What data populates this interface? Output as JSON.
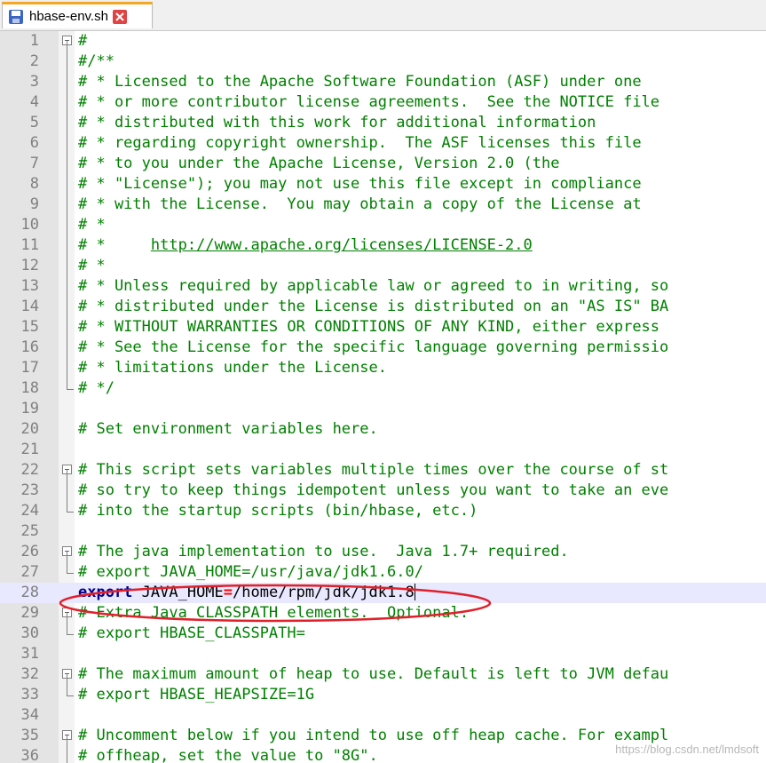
{
  "tab": {
    "filename": "hbase-env.sh"
  },
  "lines": [
    {
      "n": "1",
      "t": "#"
    },
    {
      "n": "2",
      "t": "#/**"
    },
    {
      "n": "3",
      "t": "# * Licensed to the Apache Software Foundation (ASF) under one"
    },
    {
      "n": "4",
      "t": "# * or more contributor license agreements.  See the NOTICE file"
    },
    {
      "n": "5",
      "t": "# * distributed with this work for additional information"
    },
    {
      "n": "6",
      "t": "# * regarding copyright ownership.  The ASF licenses this file"
    },
    {
      "n": "7",
      "t": "# * to you under the Apache License, Version 2.0 (the"
    },
    {
      "n": "8",
      "t": "# * \"License\"); you may not use this file except in compliance"
    },
    {
      "n": "9",
      "t": "# * with the License.  You may obtain a copy of the License at"
    },
    {
      "n": "10",
      "t": "# *"
    },
    {
      "n": "11",
      "t": "# *     ",
      "link": "http://www.apache.org/licenses/LICENSE-2.0"
    },
    {
      "n": "12",
      "t": "# *"
    },
    {
      "n": "13",
      "t": "# * Unless required by applicable law or agreed to in writing, so"
    },
    {
      "n": "14",
      "t": "# * distributed under the License is distributed on an \"AS IS\" BA"
    },
    {
      "n": "15",
      "t": "# * WITHOUT WARRANTIES OR CONDITIONS OF ANY KIND, either express"
    },
    {
      "n": "16",
      "t": "# * See the License for the specific language governing permissio"
    },
    {
      "n": "17",
      "t": "# * limitations under the License."
    },
    {
      "n": "18",
      "t": "# */"
    },
    {
      "n": "19",
      "t": ""
    },
    {
      "n": "20",
      "t": "# Set environment variables here."
    },
    {
      "n": "21",
      "t": ""
    },
    {
      "n": "22",
      "t": "# This script sets variables multiple times over the course of st"
    },
    {
      "n": "23",
      "t": "# so try to keep things idempotent unless you want to take an eve"
    },
    {
      "n": "24",
      "t": "# into the startup scripts (bin/hbase, etc.)"
    },
    {
      "n": "25",
      "t": ""
    },
    {
      "n": "26",
      "t": "# The java implementation to use.  Java 1.7+ required."
    },
    {
      "n": "27",
      "t": "# export JAVA_HOME=/usr/java/jdk1.6.0/"
    },
    {
      "n": "28",
      "kw": "export",
      "var": " JAVA_HOME",
      "op": "=",
      "val": "/home/rpm/jdk/jdk1.8"
    },
    {
      "n": "29",
      "t": "# Extra Java CLASSPATH elements.  Optional."
    },
    {
      "n": "30",
      "t": "# export HBASE_CLASSPATH="
    },
    {
      "n": "31",
      "t": ""
    },
    {
      "n": "32",
      "t": "# The maximum amount of heap to use. Default is left to JVM defau"
    },
    {
      "n": "33",
      "t": "# export HBASE_HEAPSIZE=1G"
    },
    {
      "n": "34",
      "t": ""
    },
    {
      "n": "35",
      "t": "# Uncomment below if you intend to use off heap cache. For exampl"
    },
    {
      "n": "36",
      "t": "# offheap, set the value to \"8G\"."
    }
  ],
  "watermark": "https://blog.csdn.net/lmdsoft",
  "colors": {
    "comment": "#008000",
    "keyword": "#00008b",
    "highlight": "#e8e8ff",
    "annotation": "#e0202a"
  }
}
